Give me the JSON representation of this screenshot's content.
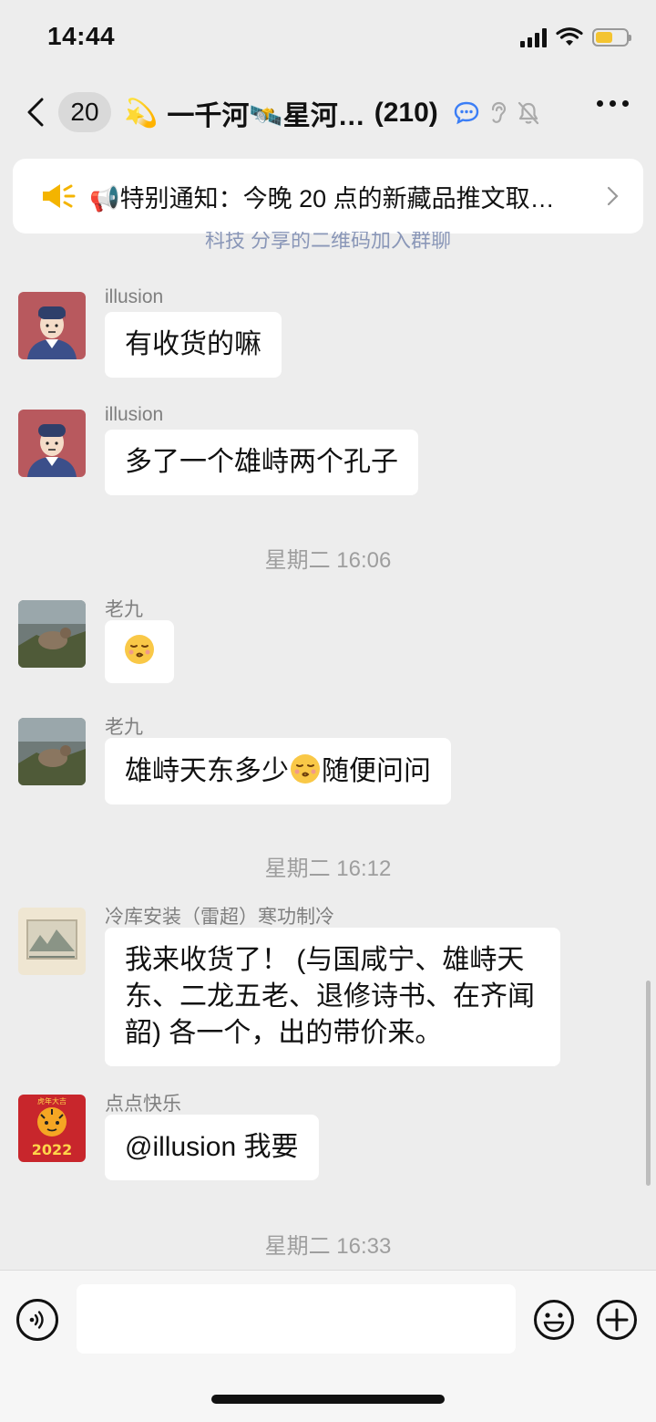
{
  "status_bar": {
    "time": "14:44",
    "battery_level": 0.55
  },
  "nav": {
    "unread_count": "20",
    "title_emoji_left": "💫",
    "title": "一千河🛰️星河…",
    "member_count": "(210)"
  },
  "notice": {
    "text": "📢特别通知：今晚 20 点的新藏品推文取…"
  },
  "partial_system_line": "科技  分享的二维码加入群聊",
  "messages": [
    {
      "sender": "illusion",
      "text": "有收货的嘛"
    },
    {
      "sender": "illusion",
      "text": "多了一个雄峙两个孔子"
    },
    {
      "sender": "老九",
      "text": ""
    },
    {
      "sender": "老九",
      "text_before": "雄峙天东多少",
      "text_after": "随便问问"
    },
    {
      "sender": "冷库安装（雷超）寒功制冷",
      "text": "我来收货了！ (与国咸宁、雄峙天东、二龙五老、退修诗书、在齐闻韶) 各一个，出的带价来。"
    },
    {
      "sender": "点点快乐",
      "text": "@illusion 我要",
      "avatar_text": "2022",
      "avatar_caption": "虎年大吉"
    }
  ],
  "timestamps": [
    "星期二 16:06",
    "星期二 16:12",
    "星期二 16:33"
  ],
  "input": {
    "placeholder": ""
  },
  "colors": {
    "background": "#ededed",
    "bubble": "#ffffff",
    "accent_blue": "#3b7ef6",
    "notice_icon": "#f4b400"
  }
}
